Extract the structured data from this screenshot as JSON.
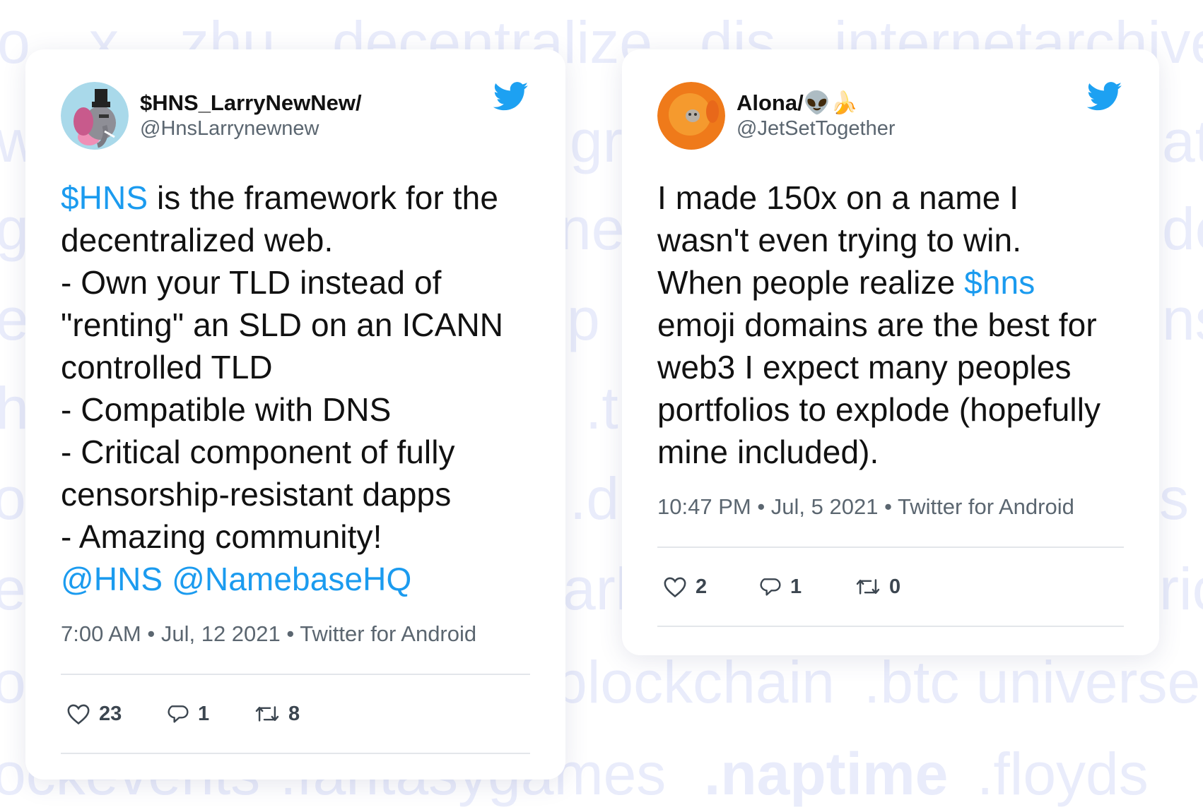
{
  "background_words": {
    "row1": [
      "o",
      "x",
      "zhu",
      "decentralize",
      "dis",
      "internetarchive"
    ],
    "row2": [
      "w",
      "gri",
      "ate"
    ],
    "row3": [
      "gi",
      "ned",
      "de"
    ],
    "row4": [
      "ei",
      "p",
      "ns"
    ],
    "row5": [
      "h",
      ".t"
    ],
    "row6": [
      "ob",
      ".d",
      "s"
    ],
    "row7": [
      "ez",
      "ark",
      "ric"
    ],
    "row8": [
      "oc",
      "blockchain",
      ".btc universe"
    ],
    "row9": [
      "ockevents",
      ".fantasygames",
      ".naptime",
      ".floyds"
    ]
  },
  "tweets": [
    {
      "display_name": "$HNS_LarryNewNew/",
      "handle": "@HnsLarrynewnew",
      "text_segments": [
        {
          "t": "$HNS",
          "link": true
        },
        {
          "t": " is the framework for the\ndecentralized web.\n- Own your TLD instead of\n\"renting\" an SLD on an ICANN\ncontrolled TLD\n- Compatible with DNS\n- Critical component of fully\ncensorship-resistant dapps\n- Amazing community!\n",
          "link": false
        },
        {
          "t": "@HNS",
          "link": true
        },
        {
          "t": " ",
          "link": false
        },
        {
          "t": "@NamebaseHQ",
          "link": true
        }
      ],
      "time": "7:00 AM",
      "date": "Jul, 12 2021",
      "source": "Twitter for Android",
      "likes": "23",
      "replies": "1",
      "retweets": "8"
    },
    {
      "display_name": "Alona/👽🍌",
      "handle": "@JetSetTogether",
      "text_segments": [
        {
          "t": "I made 150x on a name I\nwasn't even trying to win.\nWhen people realize ",
          "link": false
        },
        {
          "t": "$hns",
          "link": true
        },
        {
          "t": "\nemoji domains are the best for\nweb3 I expect many peoples\nportfolios to explode (hopefully\nmine included).",
          "link": false
        }
      ],
      "time": "10:47 PM",
      "date": "Jul, 5 2021",
      "source": "Twitter for Android",
      "likes": "2",
      "replies": "1",
      "retweets": "0"
    }
  ],
  "icons": {
    "brand": "twitter-bird-icon",
    "like": "heart-icon",
    "reply": "speech-bubble-icon",
    "retweet": "retweet-icon"
  },
  "colors": {
    "link": "#1b9bef",
    "twitter_blue": "#1da1f2",
    "bg_words": "#e9ecfb",
    "muted": "#5b6670"
  }
}
